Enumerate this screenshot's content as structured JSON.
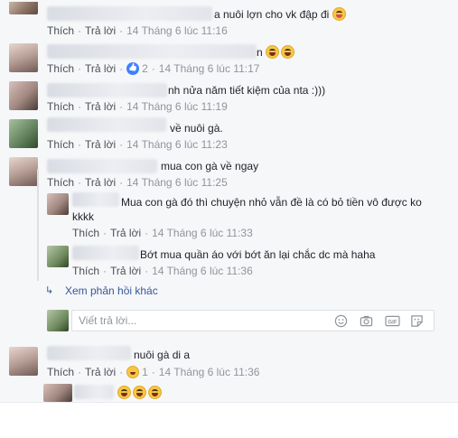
{
  "labels": {
    "like": "Thích",
    "reply": "Trả lời",
    "sep": "·"
  },
  "comments": [
    {
      "text": "a nuôi lợn cho vk đập đi",
      "time": "14 Tháng 6 lúc 11:16",
      "emoji": "tongue"
    },
    {
      "text": "n",
      "time": "14 Tháng 6 lúc 11:17",
      "emoji": "haha-double",
      "reaction": {
        "type": "like",
        "count": "2"
      }
    },
    {
      "text": "nh nửa năm tiết kiệm của nta :)))",
      "time": "14 Tháng 6 lúc 11:19"
    },
    {
      "text": "về nuôi gà.",
      "time": "14 Tháng 6 lúc 11:23"
    },
    {
      "text": "mua con gà về ngay",
      "time": "14 Tháng 6 lúc 11:25"
    }
  ],
  "replies": [
    {
      "text_line1": "Mua con gà đó thì chuyện nhỏ vẫn đề là có bỏ tiền vô được ko",
      "text_line2": "kkkk",
      "time": "14 Tháng 6 lúc 11:33"
    },
    {
      "text": "Bớt mua quần áo với bớt ăn lại chắc dc mà haha",
      "time": "14 Tháng 6 lúc 11:36"
    }
  ],
  "more_replies_label": "Xem phản hồi khác",
  "reply_input": {
    "placeholder": "Viết trả lời...",
    "icons": [
      "smile-icon",
      "camera-icon",
      "gif-icon",
      "sticker-icon"
    ]
  },
  "comment6": {
    "text": "nuôi gà di a",
    "time": "14 Tháng 6 lúc 11:36",
    "reaction": {
      "type": "haha",
      "count": "1"
    }
  },
  "comment7": {
    "emoji": "haha-triple"
  },
  "icons": {
    "more_replies": "reply-arrow-icon"
  },
  "colors": {
    "link": "#365899",
    "meta": "#90949c",
    "panel": "#f6f7f9"
  }
}
